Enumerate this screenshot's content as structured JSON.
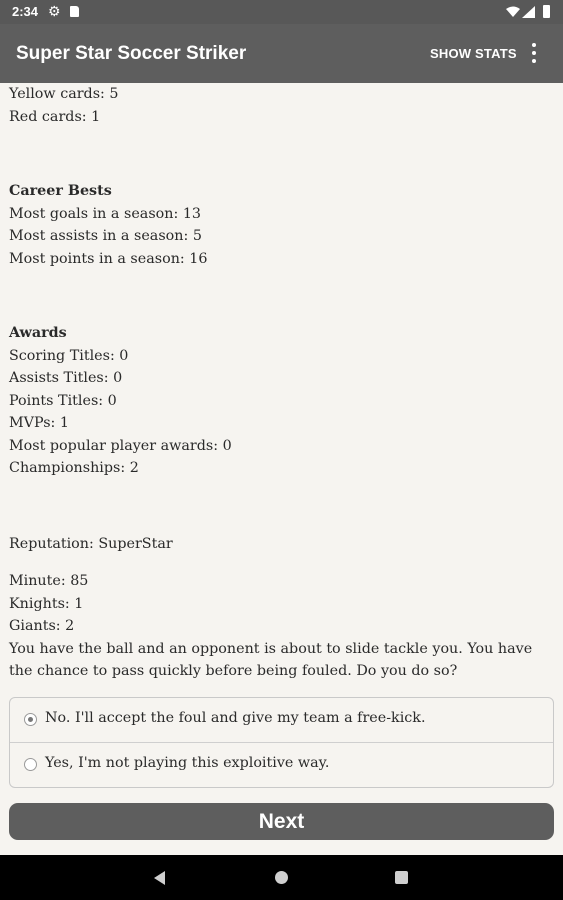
{
  "status_bar": {
    "time": "2:34",
    "icons": [
      "gear-icon",
      "sd-card-icon",
      "wifi-icon",
      "signal-icon",
      "battery-icon"
    ]
  },
  "app_bar": {
    "title": "Super Star Soccer Striker",
    "show_stats": "SHOW STATS",
    "menu_icon": "more-vertical-icon"
  },
  "stats": {
    "yellow_cards": "Yellow cards: 5",
    "red_cards": "Red cards: 1",
    "career_bests": {
      "heading": "Career Bests",
      "items": [
        "Most goals in a season: 13",
        "Most assists in a season: 5",
        "Most points in a season: 16"
      ]
    },
    "awards": {
      "heading": "Awards",
      "items": [
        "Scoring Titles: 0",
        "Assists Titles: 0",
        "Points Titles: 0",
        "MVPs: 1",
        "Most popular player awards: 0",
        "Championships: 2"
      ]
    },
    "reputation": "Reputation: SuperStar"
  },
  "game": {
    "minute": "Minute: 85",
    "team1": "Knights: 1",
    "team2": "Giants: 2",
    "question": "You have the ball and an opponent is about to slide tackle you. You have the chance to pass quickly before being fouled. Do you do so?"
  },
  "options": [
    {
      "label": "No. I'll accept the foul and give my team a free-kick.",
      "selected": true
    },
    {
      "label": "Yes, I'm not playing this exploitive way.",
      "selected": false
    }
  ],
  "next_button": "Next",
  "colors": {
    "app_bar": "#5e5e5e",
    "status_bar": "#585858",
    "background": "#f6f4f0",
    "button": "#5e5e5e"
  },
  "nav_bar": {
    "icons": [
      "back-icon",
      "home-icon",
      "recents-icon"
    ]
  }
}
